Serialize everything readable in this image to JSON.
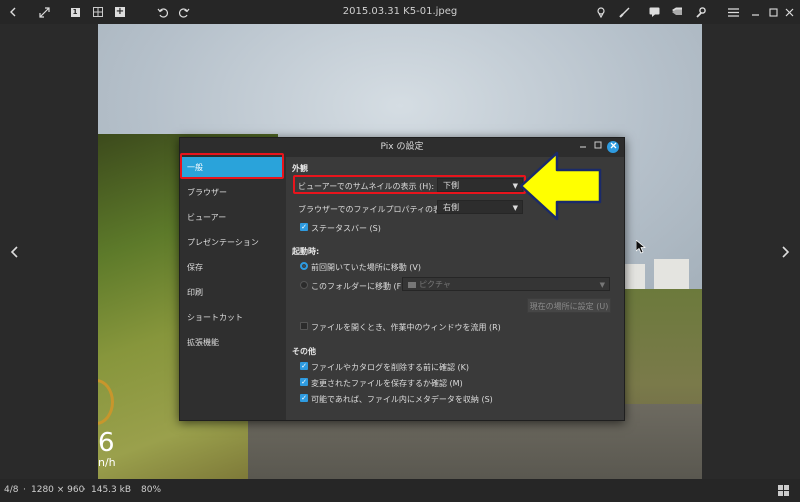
{
  "window": {
    "title": "2015.03.31 K5-01.jpeg"
  },
  "toolbar": {
    "left_icons": [
      "back-icon",
      "fullscreen-icon",
      "single-view-icon",
      "grid-view-icon",
      "add-icon",
      "undo-icon",
      "redo-icon"
    ],
    "right_icons": [
      "location-icon",
      "brush-icon",
      "comment-icon",
      "tag-icon",
      "wrench-icon",
      "menu-icon",
      "minimize-icon",
      "maximize-icon",
      "close-icon"
    ],
    "single_view_label": "1",
    "add_label": "+"
  },
  "photo": {
    "speed": "6",
    "speed_unit": "n/h"
  },
  "statusbar": {
    "position": "4/8",
    "dimensions": "1280 × 960",
    "filesize": "145.3 kB",
    "zoom": "80%",
    "sep": "·"
  },
  "dialog": {
    "title": "Pix の設定",
    "sidebar": [
      "一般",
      "ブラウザー",
      "ビューアー",
      "プレゼンテーション",
      "保存",
      "印刷",
      "ショートカット",
      "拡張機能"
    ],
    "appearance": {
      "heading": "外観",
      "viewer_thumb_label": "ビューアーでのサムネイルの表示 (H):",
      "viewer_thumb_value": "下側",
      "browser_props_label": "ブラウザーでのファイルプロパティの表示 (P):",
      "browser_props_value": "右側",
      "statusbar_label": "ステータスバー (S)",
      "statusbar_checked": true
    },
    "startup": {
      "heading": "起動時:",
      "last_location_label": "前回開いていた場所に移動 (V)",
      "folder_label": "このフォルダーに移動 (F):",
      "folder_value": "ピクチャ",
      "use_current_button": "現在の場所に設定 (U)",
      "reuse_window_label": "ファイルを開くとき、作業中のウィンドウを流用 (R)"
    },
    "other": {
      "heading": "その他",
      "confirm_delete_label": "ファイルやカタログを削除する前に確認 (K)",
      "confirm_save_label": "変更されたファイルを保存するか確認 (M)",
      "save_metadata_label": "可能であれば、ファイル内にメタデータを収納 (S)"
    }
  },
  "colors": {
    "accent": "#2e9be0",
    "highlight": "#e8141c",
    "arrow": "#ffff00"
  }
}
